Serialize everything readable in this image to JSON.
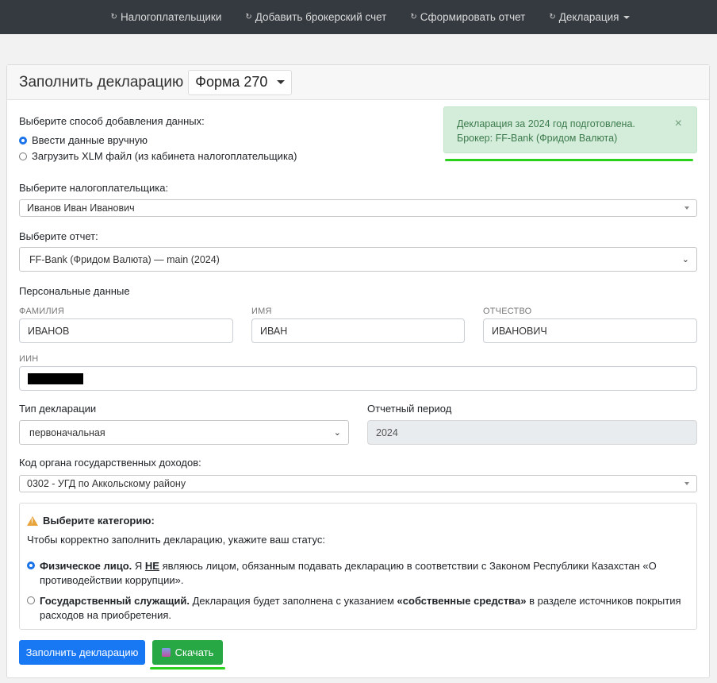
{
  "nav": {
    "items": [
      {
        "label": "Налогоплательщики"
      },
      {
        "label": "Добавить брокерский счет"
      },
      {
        "label": "Сформировать отчет"
      },
      {
        "label": "Декларация"
      }
    ],
    "icon": "refresh-icon"
  },
  "header": {
    "title": "Заполнить декларацию",
    "form_select": "Форма 270"
  },
  "alert": {
    "line1": "Декларация за 2024 год подготовлена.",
    "line2": "Брокер: FF-Bank (Фридом Валюта)",
    "close": "×",
    "color": "#d4edda"
  },
  "method": {
    "label": "Выберите способ добавления данных:",
    "opt_manual": "Ввести данные вручную",
    "opt_upload": "Загрузить XLM файл (из кабинета налогоплательщика)"
  },
  "taxpayer": {
    "label": "Выберите налогоплательщика:",
    "value": "Иванов Иван Иванович"
  },
  "report": {
    "label": "Выберите отчет:",
    "value": "FF-Bank (Фридом Валюта) — main (2024)"
  },
  "personal": {
    "label": "Персональные данные",
    "lastname_label": "ФАМИЛИЯ",
    "lastname": "ИВАНОВ",
    "firstname_label": "ИМЯ",
    "firstname": "ИВАН",
    "middlename_label": "ОТЧЕСТВО",
    "middlename": "ИВАНОВИЧ",
    "iin_label": "ИИН"
  },
  "decl_type": {
    "label": "Тип декларации",
    "value": "первоначальная"
  },
  "period": {
    "label": "Отчетный период",
    "value": "2024"
  },
  "org": {
    "label": "Код органа государственных доходов:",
    "value": "0302 - УГД по Аккольскому району"
  },
  "category": {
    "title": "Выберите категорию:",
    "subtitle": "Чтобы корректно заполнить декларацию, укажите ваш статус:",
    "opt1_bold": "Физическое лицо.",
    "opt1_pre": " Я ",
    "opt1_not": "НЕ",
    "opt1_rest": " являюсь лицом, обязанным подавать декларацию в соответствии с Законом Республики Казахстан «О противодействии коррупции».",
    "opt2_bold": "Государственный служащий.",
    "opt2_pre": " Декларация будет заполнена с указанием ",
    "opt2_quote": "«собственные средства»",
    "opt2_rest": " в разделе источников покрытия расходов на приобретения."
  },
  "buttons": {
    "fill": "Заполнить декларацию",
    "download": "Скачать"
  },
  "colors": {
    "primary": "#1877f2",
    "success": "#28a745",
    "highlight": "#2bd11c"
  }
}
